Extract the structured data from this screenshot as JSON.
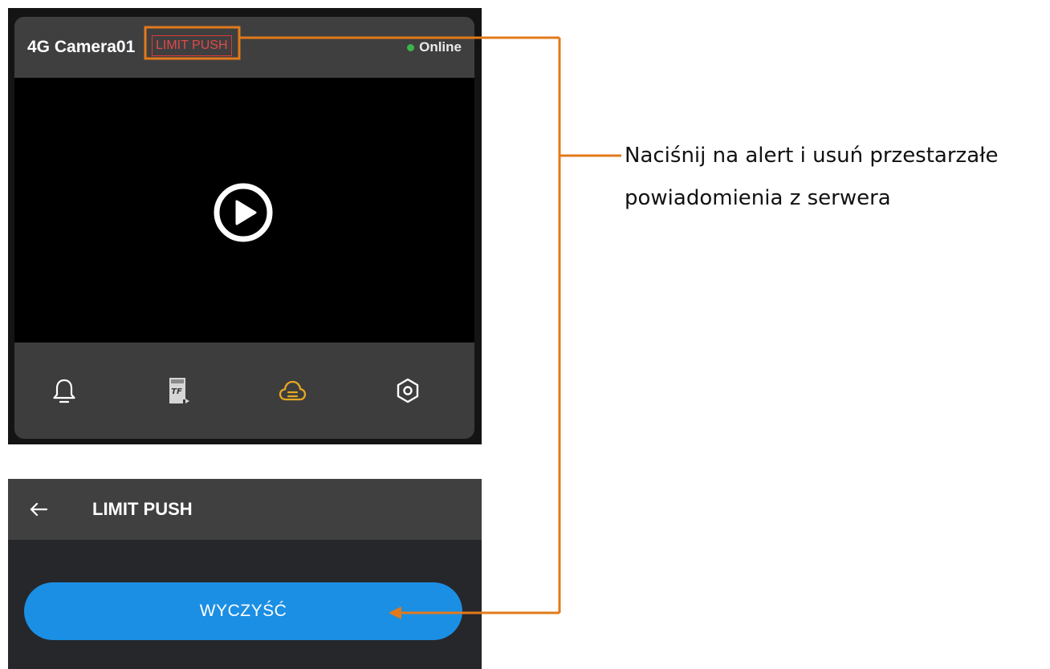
{
  "camera_card": {
    "name": "4G Camera01",
    "alert_badge": "LIMIT PUSH",
    "status": "Online",
    "status_color": "#3cb44a",
    "toolbar": [
      {
        "icon": "bell-icon"
      },
      {
        "icon": "sd-card-icon",
        "text": "TF"
      },
      {
        "icon": "cloud-storage-icon",
        "active": true,
        "color": "#e5a823"
      },
      {
        "icon": "settings-icon"
      }
    ]
  },
  "limit_push_page": {
    "back_icon": "arrow-left-icon",
    "title": "LIMIT PUSH",
    "clear_button": "WYCZYŚĆ",
    "button_color": "#1b8fe3"
  },
  "annotation": {
    "text": "Naciśnij na alert i usuń przestarzałe powiadomienia z serwera",
    "color": "#e27a1b"
  }
}
